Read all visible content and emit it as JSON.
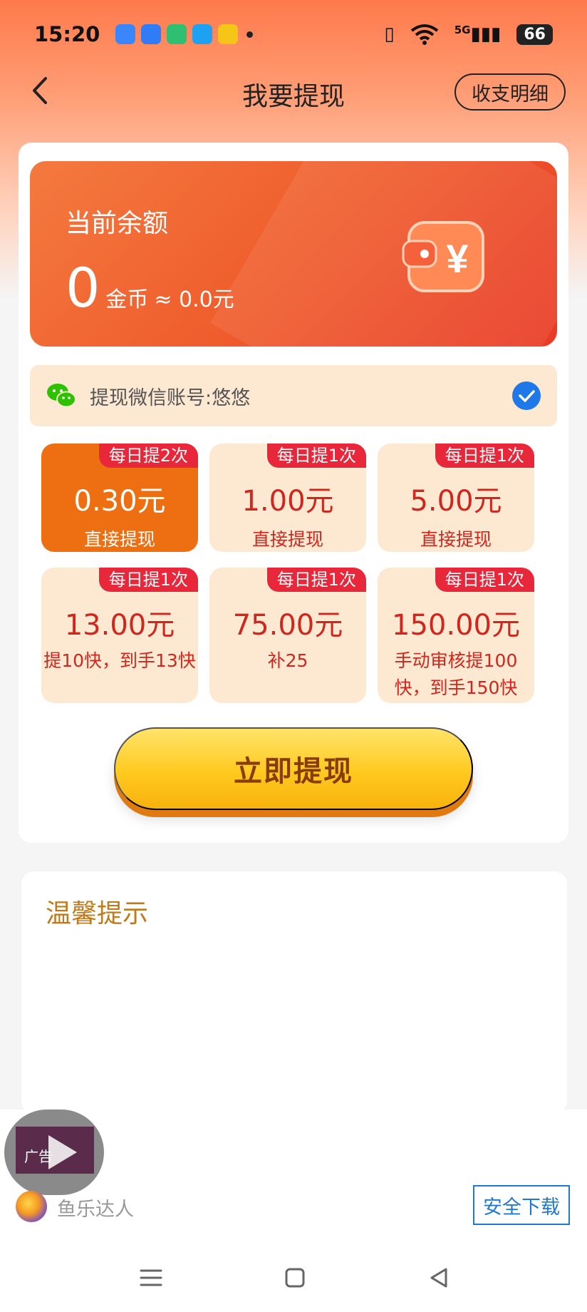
{
  "status_bar": {
    "time": "15:20",
    "notif_colors": [
      "#3a86ff",
      "#2f7cf6",
      "#2fbf71",
      "#1da1f2",
      "#f5c518"
    ],
    "network": "5G",
    "battery": "66"
  },
  "nav": {
    "back_icon": "chevron-left-icon",
    "title": "我要提现",
    "detail_label": "收支明细"
  },
  "balance": {
    "label": "当前余额",
    "amount": "0",
    "unit": "金币",
    "approx": "≈ 0.0元"
  },
  "wechat": {
    "label": "提现微信账号:悠悠",
    "checked": true
  },
  "options": [
    {
      "badge": "每日提2次",
      "amount": "0.30元",
      "desc": "直接提现",
      "selected": true
    },
    {
      "badge": "每日提1次",
      "amount": "1.00元",
      "desc": "直接提现",
      "selected": false
    },
    {
      "badge": "每日提1次",
      "amount": "5.00元",
      "desc": "直接提现",
      "selected": false
    },
    {
      "badge": "每日提1次",
      "amount": "13.00元",
      "desc": "提10快，到手13快",
      "selected": false
    },
    {
      "badge": "每日提1次",
      "amount": "75.00元",
      "desc": "补25",
      "selected": false
    },
    {
      "badge": "每日提1次",
      "amount": "150.00元",
      "desc": "手动审核提100快，到手150快",
      "selected": false
    }
  ],
  "withdraw_button": "立即提现",
  "tips": {
    "title": "温馨提示"
  },
  "ad": {
    "label": "广告",
    "app_name": "鱼乐达人",
    "download_label": "安全下载"
  },
  "colors": {
    "accent_orange": "#ee6f12",
    "badge_red": "#e8283a",
    "amount_red": "#d0261d",
    "button_yellow": "#ffc91f",
    "tips_title": "#c07a1a"
  }
}
